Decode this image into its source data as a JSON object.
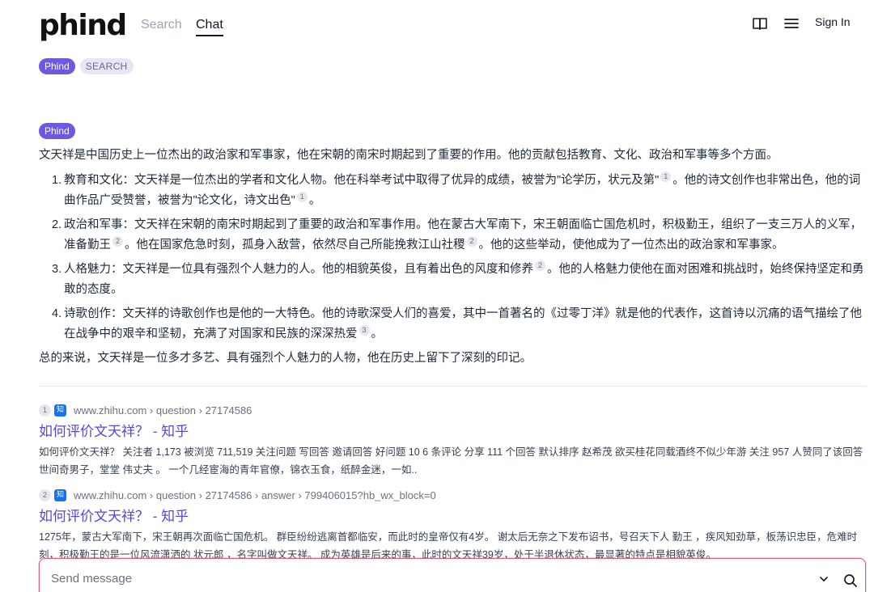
{
  "header": {
    "logo": "phind",
    "nav": {
      "search": "Search",
      "chat": "Chat"
    },
    "sign_in": "Sign In",
    "icons": [
      "book-icon",
      "menu-icon"
    ]
  },
  "tags": {
    "phind": "Phind",
    "search": "SEARCH"
  },
  "answer": {
    "badge": "Phind",
    "intro": "文天祥是中国历史上一位杰出的政治家和军事家，他在宋朝的南宋时期起到了重要的作用。他的贡献包括教育、文化、政治和军事等多个方面。",
    "items": [
      {
        "num": "1.",
        "parts": [
          "教育和文化：文天祥是一位杰出的学者和文化人物。他在科举考试中取得了优异的成绩，被誉为\"论学历，状元及第\"",
          "。他的诗文创作也非常出色，他的词曲作品广受赞誉，被誉为\"论文化，诗文出色\"",
          "。"
        ],
        "cites": [
          "1",
          "1"
        ]
      },
      {
        "num": "2.",
        "parts": [
          "政治和军事：文天祥在宋朝的南宋时期起到了重要的政治和军事作用。他在蒙古大军南下，宋王朝面临亡国危机时，积极勤王，组织了一支三万人的义军，准备勤王",
          "。他在国家危急时刻，孤身入敌营，依然尽自己所能挽救江山社稷",
          "。他的这些举动，使他成为了一位杰出的政治家和军事家。"
        ],
        "cites": [
          "2",
          "2"
        ]
      },
      {
        "num": "3.",
        "parts": [
          "人格魅力：文天祥是一位具有强烈个人魅力的人。他的相貌英俊，且有着出色的风度和修养",
          "。他的人格魅力使他在面对困难和挑战时，始终保持坚定和勇敢的态度。"
        ],
        "cites": [
          "2"
        ]
      },
      {
        "num": "4.",
        "parts": [
          "诗歌创作：文天祥的诗歌创作也是他的一大特色。他的诗歌深受人们的喜爱，其中一首著名的《过零丁洋》就是他的代表作，这首诗以沉痛的语气描绘了他在战争中的艰辛和坚韧，充满了对国家和民族的深深热爱",
          "。"
        ],
        "cites": [
          "3"
        ]
      }
    ],
    "summary": "总的来说，文天祥是一位多才多艺、具有强烈个人魅力的人物，他在历史上留下了深刻的印记。"
  },
  "sources": [
    {
      "num": "1",
      "favicon": "知",
      "url": "www.zhihu.com › question › 27174586",
      "title": "如何评价文天祥？ - 知乎",
      "snippet": "如何评价文天祥？ 关注者 1,173 被浏览 711,519 关注问题 写回答 邀请回答 好问题 10 6 条评论 分享 111 个回答 默认排序 赵希茂 欲买桂花同载酒终不似少年游 关注 957 人赞同了该回答 世间奇男子，堂堂 伟丈夫 。 一个几经宦海的青年官僚，锦衣玉食，纸醉金迷，一如.."
    },
    {
      "num": "2",
      "favicon": "知",
      "url": "www.zhihu.com › question › 27174586 › answer › 799406015?hb_wx_block=0",
      "title": "如何评价文天祥？ - 知乎",
      "snippet": "1275年，蒙古大军南下，宋王朝再次面临亡国危机。 群臣纷纷逃离首都临安，而此时的皇帝仅有4岁。 谢太后无奈之下发布诏书，号召天下人 勤王 ，疾风知劲草，板荡识忠臣，危难时刻，积极勤王的是一位风流潇洒的 状元郎 ，名字叫做文天祥。 成为英雄是后来的事，此时的文天祥39岁，处于半退休状态，最显著的特点是相貌英俊。"
    }
  ],
  "input": {
    "placeholder": "Send message"
  },
  "colors": {
    "accent": "#6d5ae0",
    "link": "#5b45e0",
    "input_border": "#e05a7a"
  }
}
